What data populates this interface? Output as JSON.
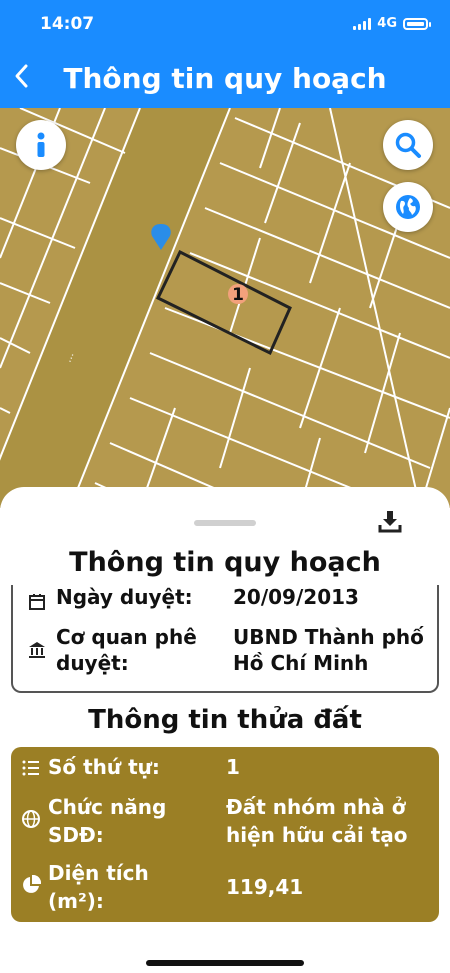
{
  "status_bar": {
    "time": "14:07",
    "network": "4G"
  },
  "header": {
    "back_icon": "chevron-left-icon",
    "title": "Thông tin quy hoạch"
  },
  "map": {
    "parcel_label": "1",
    "info_icon": "info-icon",
    "search_icon": "search-icon",
    "layers_icon": "globe-icon",
    "marker_icon": "map-pin-icon",
    "road_label": "…",
    "colors": {
      "land": "#b5994e",
      "line": "#ffffff",
      "road": "#a9903f",
      "marker": "#2a8de8"
    }
  },
  "sheet": {
    "title": "Thông tin quy hoạch",
    "download_icon": "download-icon",
    "plan": {
      "approval_date_label": "Ngày duyệt:",
      "approval_date_value": "20/09/2013",
      "agency_label_1": "Cơ quan phê",
      "agency_label_2": "duyệt:",
      "agency_value_1": "UBND Thành phố",
      "agency_value_2": "Hồ Chí Minh"
    },
    "parcel_section_title": "Thông tin thửa đất",
    "parcel": {
      "order_label": "Số thứ tự:",
      "order_value": "1",
      "function_label_1": "Chức năng",
      "function_label_2": "SDĐ:",
      "function_value_1": "Đất nhóm nhà ở",
      "function_value_2": "hiện hữu cải tạo",
      "area_label_1": "Diện tích",
      "area_label_2": "(m²):",
      "area_value": "119,41",
      "card_color": "#9b7f25"
    }
  }
}
